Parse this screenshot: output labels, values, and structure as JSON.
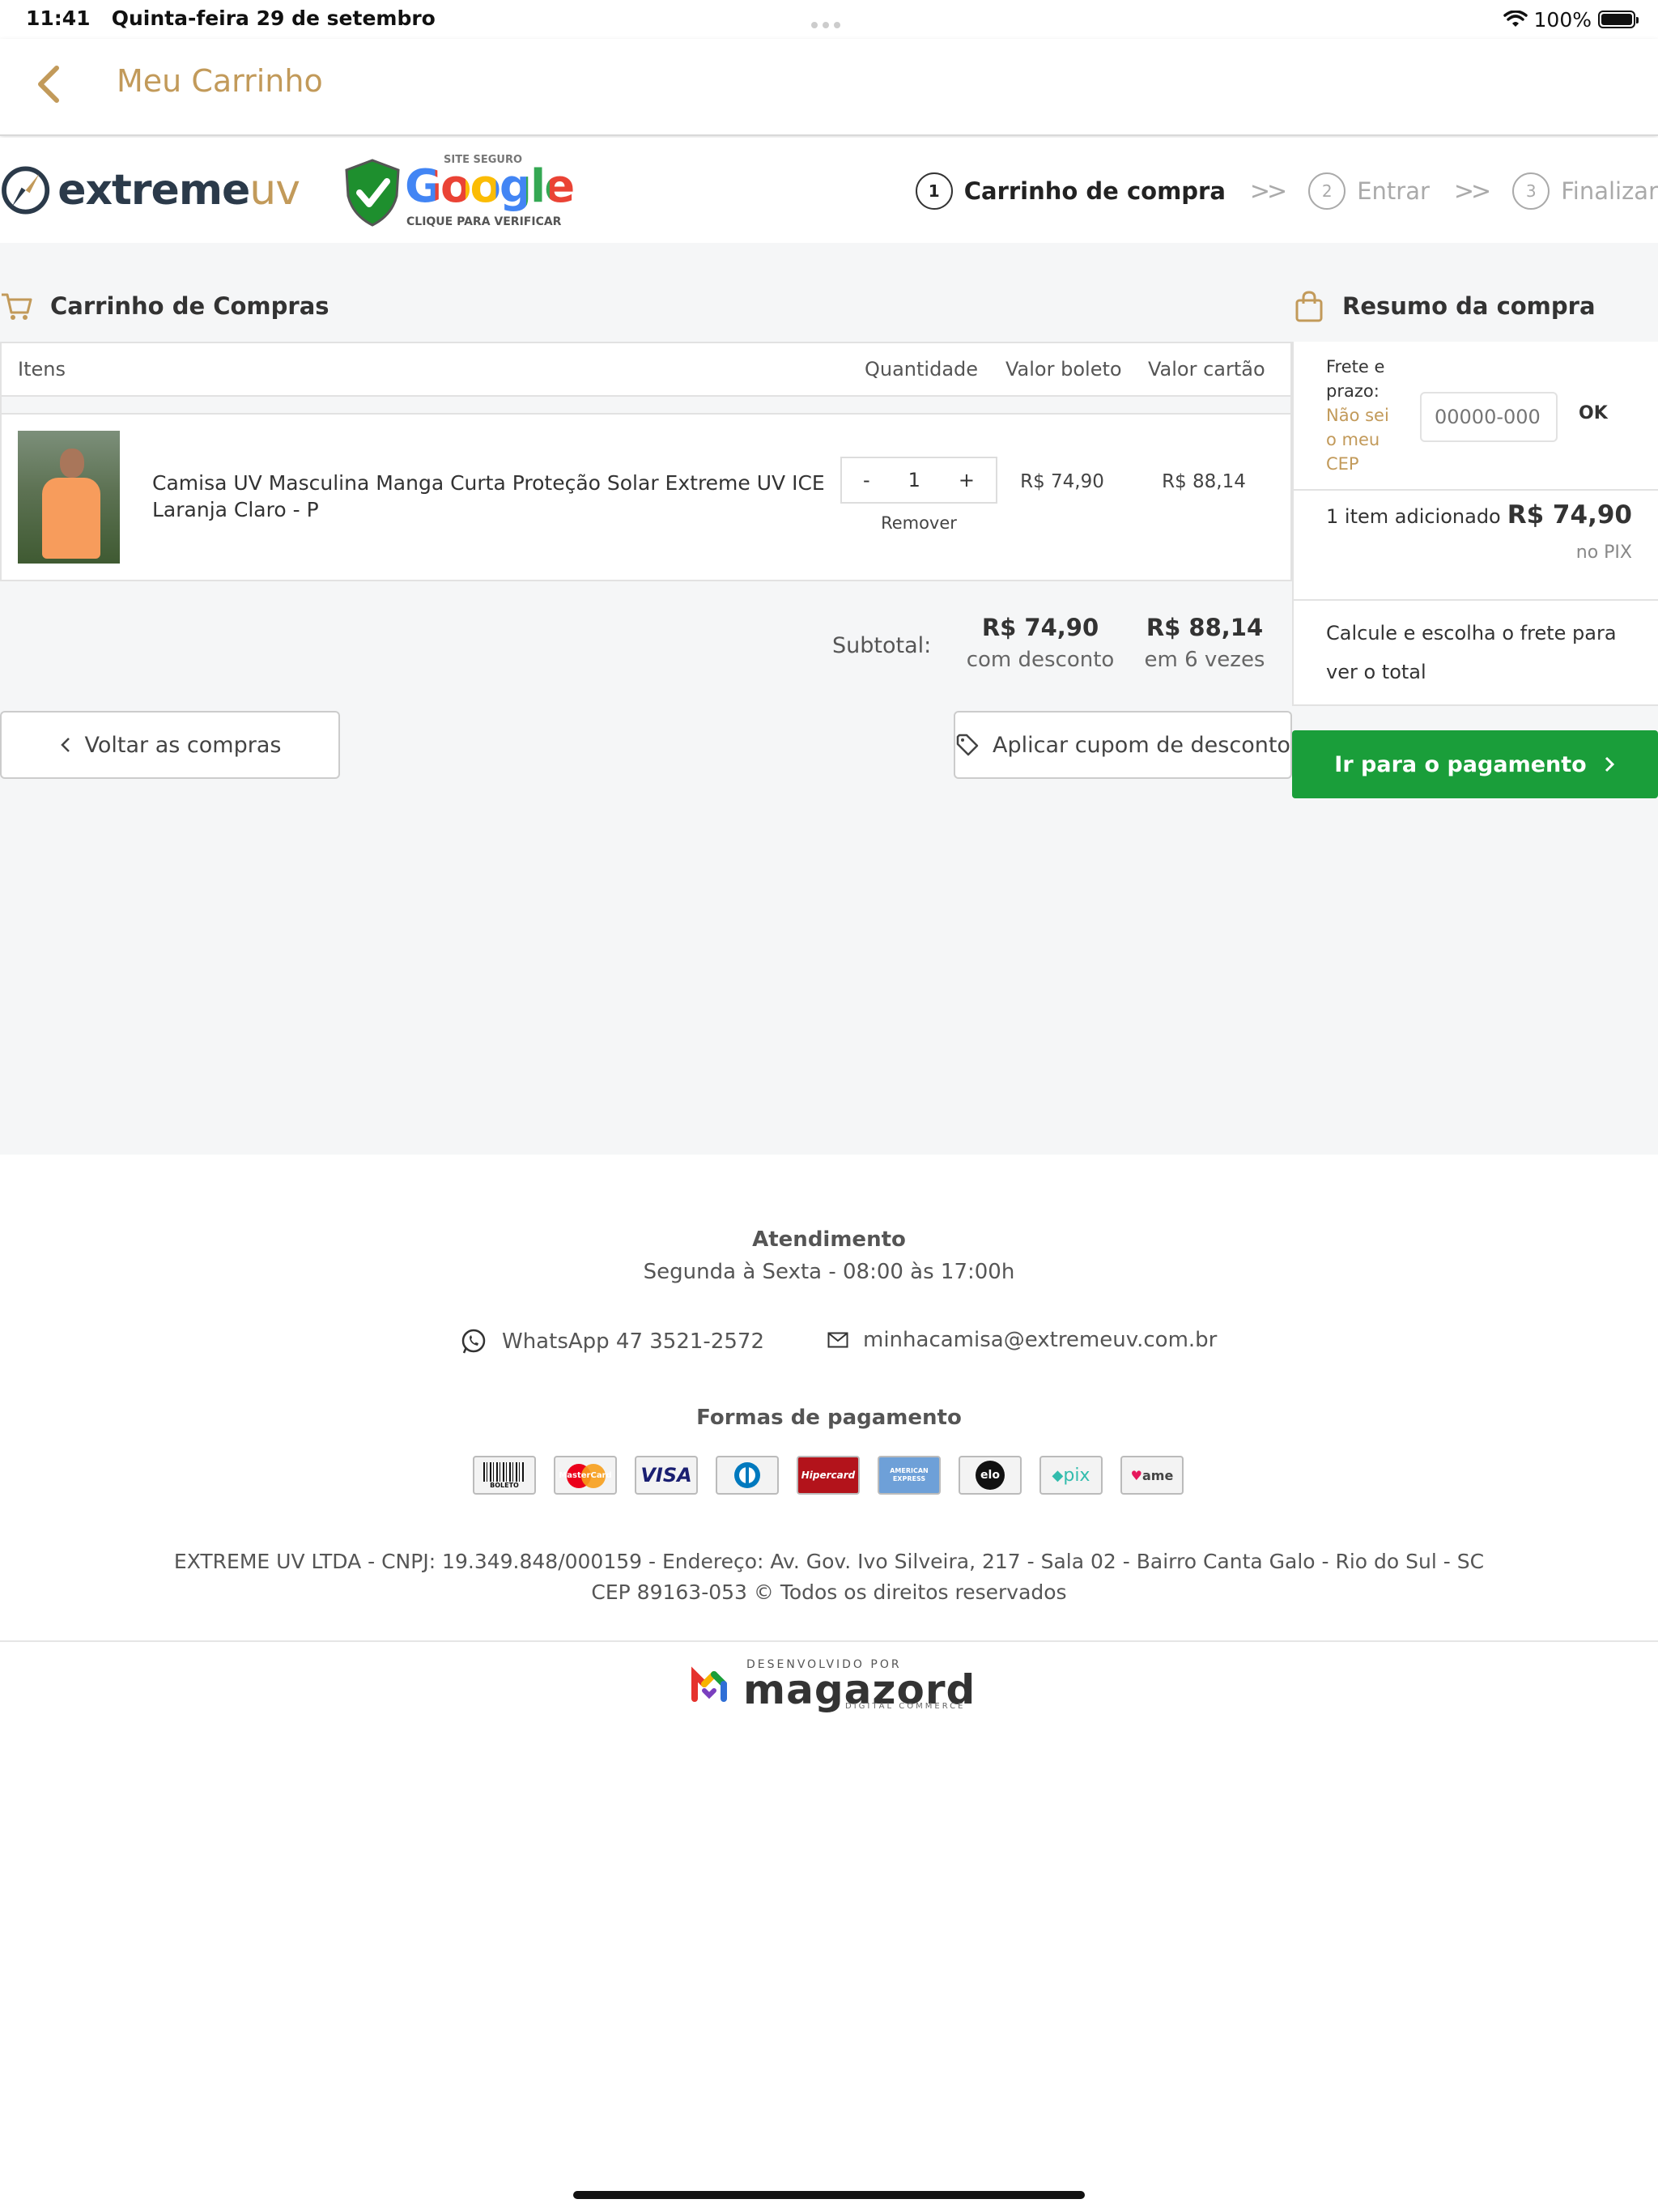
{
  "status_bar": {
    "time": "11:41",
    "date": "Quinta-feira 29 de setembro",
    "battery": "100%"
  },
  "nav": {
    "title": "Meu Carrinho"
  },
  "header": {
    "logo_text_main": "extreme",
    "logo_text_accent": "uv",
    "google_badge_top": "SITE SEGURO",
    "google_badge_word": "Google",
    "google_badge_bottom": "CLIQUE PARA VERIFICAR",
    "steps": [
      {
        "num": "1",
        "label": "Carrinho de compra"
      },
      {
        "num": "2",
        "label": "Entrar"
      },
      {
        "num": "3",
        "label": "Finalizar"
      }
    ]
  },
  "cart": {
    "title": "Carrinho de Compras",
    "columns": {
      "items": "Itens",
      "quantity": "Quantidade",
      "boleto": "Valor boleto",
      "cartao": "Valor cartão"
    },
    "item": {
      "name": "Camisa UV Masculina Manga Curta Proteção Solar Extreme UV ICE Laranja Claro - P",
      "minus": "-",
      "quantity": "1",
      "plus": "+",
      "remove": "Remover",
      "price_boleto": "R$ 74,90",
      "price_cartao": "R$ 88,14"
    },
    "subtotal_label": "Subtotal:",
    "subtotal_boleto": "R$ 74,90",
    "subtotal_boleto_note": "com desconto",
    "subtotal_cartao": "R$ 88,14",
    "subtotal_cartao_note": "em 6 vezes",
    "back_button": "Voltar as compras",
    "coupon_button": "Aplicar cupom de desconto"
  },
  "summary": {
    "title": "Resumo da compra",
    "frete_label": "Frete e prazo:",
    "frete_link": "Não sei o meu CEP",
    "cep_placeholder": "00000-000",
    "ok": "OK",
    "items_added": "1 item adicionado",
    "total": "R$ 74,90",
    "total_note": "no PIX",
    "calc_text": "Calcule e escolha o frete para ver o total",
    "pay_button": "Ir para o pagamento"
  },
  "footer": {
    "atendimento_title": "Atendimento",
    "atendimento_hours": "Segunda à Sexta - 08:00 às 17:00h",
    "whatsapp": "WhatsApp 47 3521-2572",
    "email": "minhacamisa@extremeuv.com.br",
    "payment_title": "Formas de pagamento",
    "payment_methods": [
      "BOLETO",
      "MasterCard",
      "VISA",
      "Diners",
      "Hipercard",
      "AMERICAN EXPRESS",
      "elo",
      "pix",
      "ame"
    ],
    "legal_line1": "EXTREME UV LTDA - CNPJ: 19.349.848/000159 - Endereço: Av. Gov. Ivo Silveira, 217 - Sala 02 - Bairro Canta Galo - Rio do Sul - SC",
    "legal_line2": "CEP 89163-053 © Todos os direitos reservados",
    "dev_by": "DESENVOLVIDO POR",
    "dev_name": "magazord",
    "dev_sub": "DIGITAL COMMERCE"
  },
  "colors": {
    "gold": "#c29a5a",
    "green": "#1a9e3a",
    "bg_gray": "#f5f6f7"
  }
}
